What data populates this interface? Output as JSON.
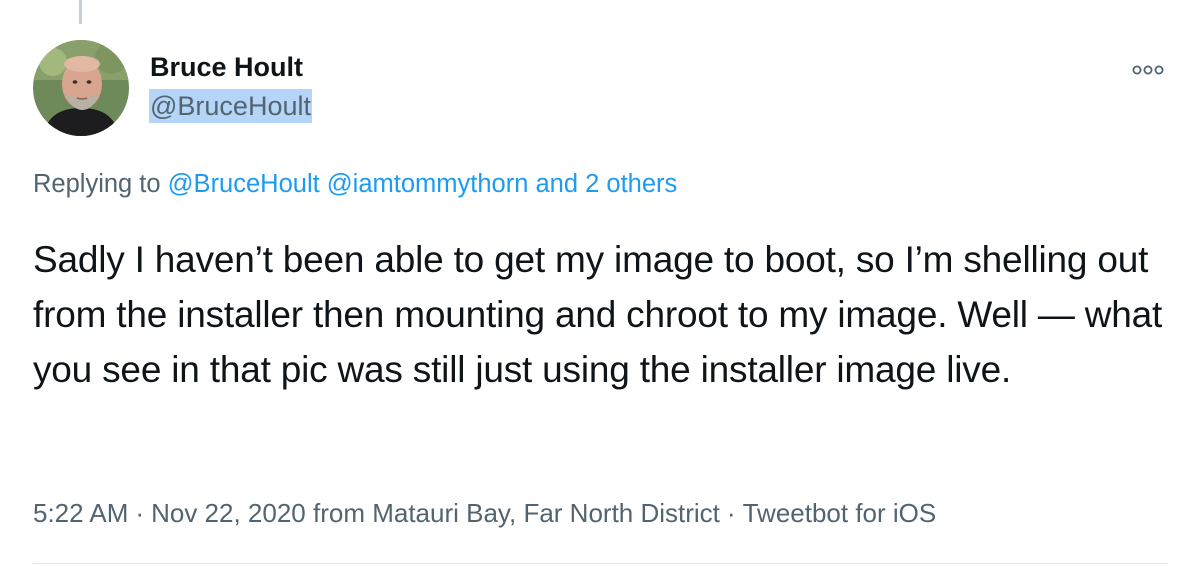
{
  "tweet": {
    "author": {
      "display_name": "Bruce Hoult",
      "handle": "@BruceHoult"
    },
    "more_icon": "more-icon",
    "replying_to": {
      "prefix": "Replying to",
      "mentions": [
        "@BruceHoult",
        "@iamtommythorn"
      ],
      "others": "and 2 others"
    },
    "text": "Sadly I haven’t been able to get my image to boot, so I’m shelling out from the installer then mounting and chroot to my image. Well — what you see in that pic was still just using the installer image live.",
    "meta": {
      "time": "5:22 AM",
      "date": "Nov 22, 2020",
      "location": "from Matauri Bay, Far North District",
      "source": "Tweetbot for iOS",
      "separator": "·"
    }
  },
  "colors": {
    "link": "#1d9bf0",
    "secondary": "#536471",
    "text": "#0f1419",
    "selection": "#b4d5f7"
  }
}
